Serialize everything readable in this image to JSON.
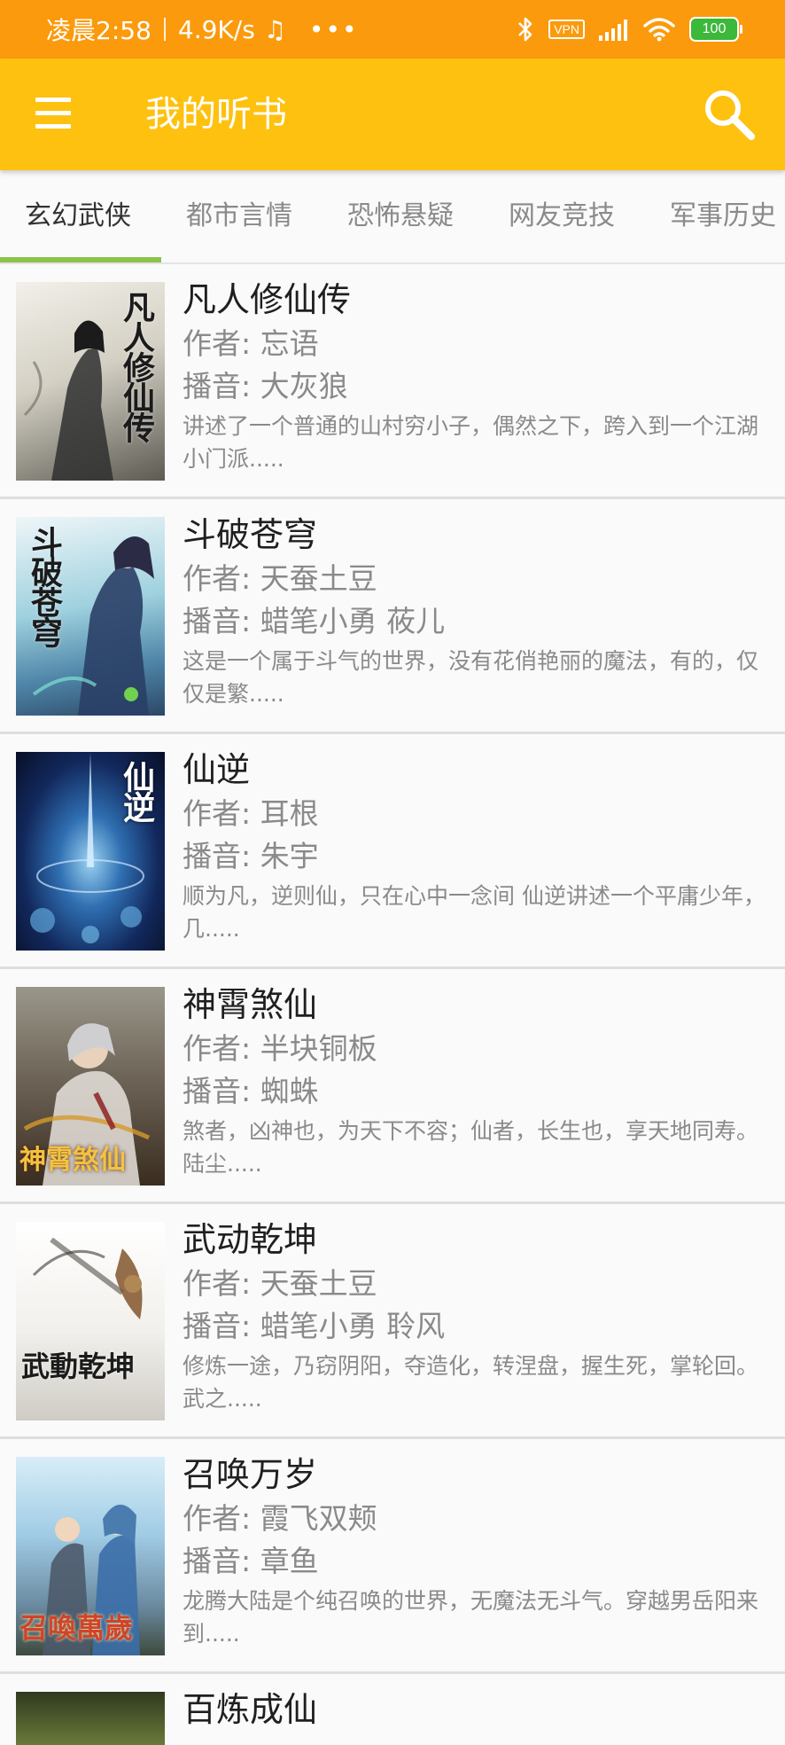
{
  "status_bar": {
    "time": "凌晨2:58",
    "speed": "4.9K/s",
    "vpn": "VPN",
    "battery": "100",
    "icons": [
      "music-note-icon",
      "more-dots-icon",
      "bluetooth-icon",
      "vpn-icon",
      "signal-icon",
      "wifi-icon",
      "battery-icon"
    ]
  },
  "app_bar": {
    "title": "我的听书",
    "menu_icon": "menu-icon",
    "search_icon": "search-icon"
  },
  "tabs": [
    {
      "label": "玄幻武侠",
      "active": true
    },
    {
      "label": "都市言情",
      "active": false
    },
    {
      "label": "恐怖悬疑",
      "active": false
    },
    {
      "label": "网友竞技",
      "active": false
    },
    {
      "label": "军事历史",
      "active": false
    }
  ],
  "author_prefix": "作者: ",
  "narrator_prefix": "播音: ",
  "books": [
    {
      "title": "凡人修仙传",
      "author": "忘语",
      "narrator": "大灰狼",
      "description": "讲述了一个普通的山村穷小子，偶然之下，跨入到一个江湖小门派.....",
      "cover_text": "凡人修仙传",
      "cover_colors": [
        "#f1efe9",
        "#b7b3a8",
        "#3a3934"
      ]
    },
    {
      "title": "斗破苍穹",
      "author": "天蚕土豆",
      "narrator": "蜡笔小勇 莜儿",
      "description": "这是一个属于斗气的世界，没有花俏艳丽的魔法，有的，仅仅是繁.....",
      "cover_text": "斗破苍穹",
      "cover_colors": [
        "#e8f1f4",
        "#79b7c9",
        "#3a5f8a"
      ]
    },
    {
      "title": "仙逆",
      "author": "耳根",
      "narrator": "朱宇",
      "description": "顺为凡，逆则仙，只在心中一念间 仙逆讲述一个平庸少年，几.....",
      "cover_text": "仙逆",
      "cover_colors": [
        "#0d1a3c",
        "#25508e",
        "#8fc3e8"
      ]
    },
    {
      "title": "神霄煞仙",
      "author": "半块铜板",
      "narrator": "蜘蛛",
      "description": "煞者，凶神也，为天下不容；仙者，长生也，享天地同寿。陆尘.....",
      "cover_text": "神霄煞仙",
      "cover_colors": [
        "#8a8778",
        "#5c4b36",
        "#2a2118"
      ]
    },
    {
      "title": "武动乾坤",
      "author": "天蚕土豆",
      "narrator": "蜡笔小勇 聆风",
      "description": "修炼一途，乃窃阴阳，夺造化，转涅盘，握生死，掌轮回。武之.....",
      "cover_text": "武動乾坤",
      "cover_colors": [
        "#ffffff",
        "#d9d6d0",
        "#6d6a63"
      ]
    },
    {
      "title": "召唤万岁",
      "author": "霞飞双颊",
      "narrator": "章鱼",
      "description": "龙腾大陆是个纯召唤的世界，无魔法无斗气。穿越男岳阳来到.....",
      "cover_text": "召喚萬歲",
      "cover_colors": [
        "#bfe0f2",
        "#6fa7c6",
        "#4a5a4a"
      ]
    }
  ],
  "partial_book": {
    "title": "百炼成仙"
  }
}
